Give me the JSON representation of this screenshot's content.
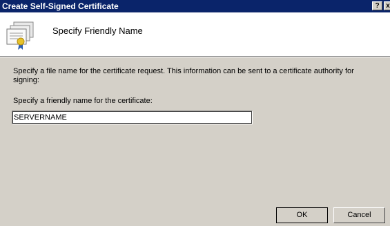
{
  "window": {
    "title": "Create Self-Signed Certificate",
    "help_label": "?",
    "close_label": "x"
  },
  "header": {
    "title": "Specify Friendly Name",
    "icon": "certificate-icon"
  },
  "main": {
    "description": "Specify a file name for the certificate request.  This information can be sent to a certificate authority for signing:",
    "field_label": "Specify a friendly name for the certificate:",
    "friendly_name_value": "SERVERNAME"
  },
  "buttons": {
    "ok_label": "OK",
    "cancel_label": "Cancel"
  },
  "colors": {
    "titlebar": "#0a246a",
    "dialog_bg": "#d4d0c8",
    "header_bg": "#ffffff"
  }
}
